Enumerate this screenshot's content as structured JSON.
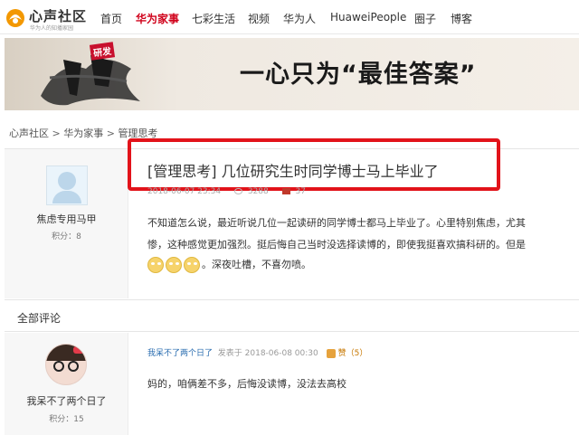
{
  "nav": {
    "logo_text": "心声社区",
    "logo_sub": "华为人的知播家园",
    "items": [
      "首页",
      "华为家事",
      "七彩生活",
      "视频",
      "华为人",
      "HuaweiPeople",
      "圈子",
      "博客"
    ],
    "active_index": 1
  },
  "banner": {
    "tag": "研发",
    "slogan": "一心只为“最佳答案”"
  },
  "breadcrumb": [
    "心声社区",
    "华为家事",
    "管理思考"
  ],
  "post": {
    "title": "[管理思考] 几位研究生时同学博士马上毕业了",
    "meta_date": "2018-06-07 23:34",
    "meta_views": "3288",
    "meta_comments": "37",
    "author": "焦虑专用马甲",
    "score": "积分：8",
    "content_lines": [
      "不知道怎么说，最近听说几位一起读研的同学博士都马上毕业了。心里特别焦虑，尤其",
      "惨，这种感觉更加强烈。挺后悔自己当时没选择读博的，即使我挺喜欢搞科研的。但是",
      "。深夜吐槽，不喜勿喷。"
    ]
  },
  "comments": {
    "title": "全部评论",
    "items": [
      {
        "author": "我呆不了两个日了",
        "score": "积分：15",
        "posted_label": "发表于",
        "posted_at": "2018-06-08 00:30",
        "like_label": "赞",
        "like_count": "（5）",
        "text": "妈的，咱俩差不多，后悔没读博，没法去高校"
      }
    ]
  },
  "colors": {
    "accent_red": "#d0021b",
    "highlight_box": "#e2131a",
    "link_blue": "#2a6db0"
  }
}
